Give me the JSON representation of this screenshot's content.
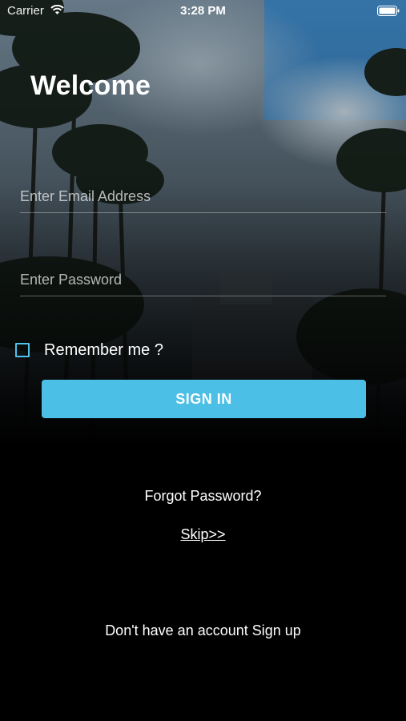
{
  "status_bar": {
    "carrier": "Carrier",
    "time": "3:28 PM"
  },
  "welcome_title": "Welcome",
  "email": {
    "placeholder": "Enter Email Address",
    "value": ""
  },
  "password": {
    "placeholder": "Enter Password",
    "value": ""
  },
  "remember": {
    "label": "Remember me ?",
    "checked": false
  },
  "sign_in_label": "SIGN IN",
  "forgot_password_label": "Forgot Password?",
  "skip_label": "Skip>>",
  "signup_label": "Don't have an account Sign up",
  "colors": {
    "accent": "#4bbfe6",
    "background": "#000000",
    "text": "#ffffff"
  },
  "icons": [
    "wifi-icon",
    "battery-icon",
    "checkbox-icon"
  ]
}
